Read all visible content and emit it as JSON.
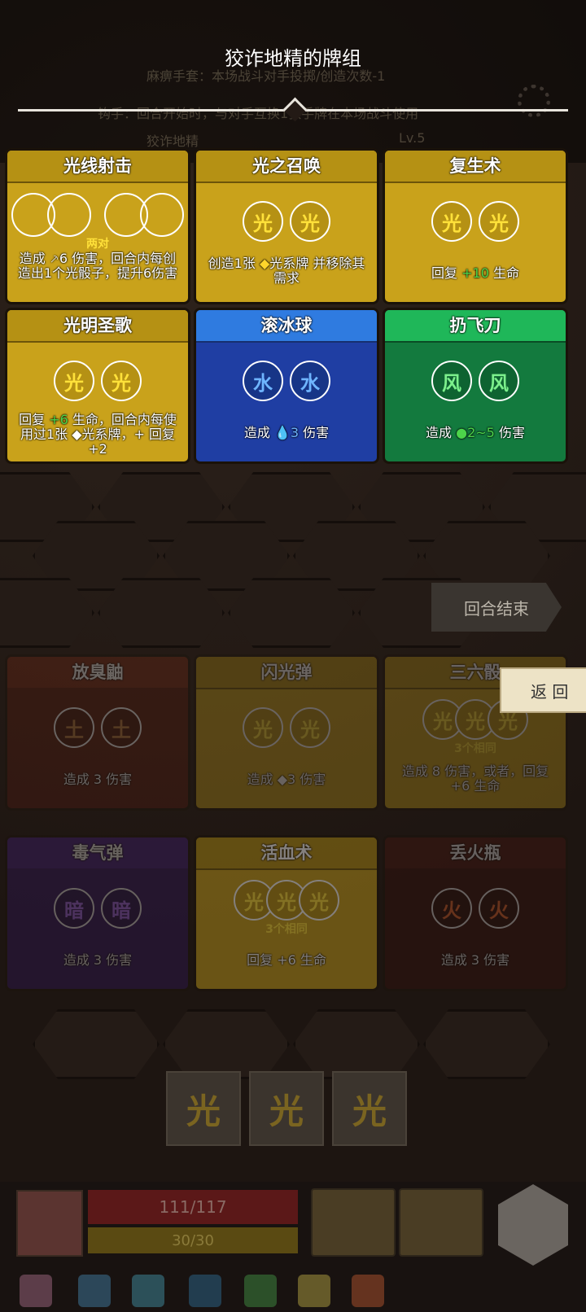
{
  "deck_title": "狡诈地精的牌组",
  "background_text": {
    "line1": "麻痹手套：本场战斗对手投掷/创造次数-1",
    "line2": "钩手：回合开始时，与对手互换1张手牌在本场战斗使用",
    "enemy_name": "狡诈地精",
    "enemy_level": "Lv.5"
  },
  "cards": [
    {
      "title": "光线射击",
      "color": "yellow",
      "dice": [
        "",
        "",
        "",
        ""
      ],
      "dice_label": "两对",
      "desc": [
        "造成 ",
        "6",
        " 伤害，回合内每创造出1个光骰子，提升6伤害"
      ]
    },
    {
      "title": "光之召唤",
      "color": "yellow",
      "dice": [
        "光",
        "光"
      ],
      "desc": [
        "创造1张 ",
        "◆",
        "光系牌 并移除其需求"
      ]
    },
    {
      "title": "复生术",
      "color": "yellow",
      "dice": [
        "光",
        "光"
      ],
      "desc": [
        "回复 ",
        "+10",
        " 生命"
      ]
    },
    {
      "title": "光明圣歌",
      "color": "yellow",
      "dice": [
        "光",
        "光"
      ],
      "desc": [
        "回复 ",
        "+6",
        " 生命，回合内每使用过1张 ◆光系牌，+ 回复+2"
      ]
    },
    {
      "title": "滚冰球",
      "color": "blue",
      "dice": [
        "水",
        "水"
      ],
      "desc": [
        "造成 ",
        "3",
        " 伤害"
      ]
    },
    {
      "title": "扔飞刀",
      "color": "green",
      "dice": [
        "风",
        "风"
      ],
      "desc": [
        "造成 ",
        "2~5",
        " 伤害"
      ]
    }
  ],
  "dim_cards": [
    {
      "title": "放臭鼬",
      "style": "dimred",
      "dice": [
        "土",
        "土"
      ],
      "desc": "造成 3 伤害"
    },
    {
      "title": "闪光弹",
      "style": "yellow",
      "dice": [
        "光",
        "光"
      ],
      "desc": "造成 ◆3 伤害"
    },
    {
      "title": "三六骰",
      "style": "yellow",
      "dice": [
        "光",
        "光",
        "光"
      ],
      "dice_label": "3个相同",
      "desc": "造成 8 伤害，或者，回复 +6 生命"
    },
    {
      "title": "毒气弹",
      "style": "dimpurple",
      "dice": [
        "暗",
        "暗"
      ],
      "desc": "造成 3 伤害"
    },
    {
      "title": "活血术",
      "style": "yellow",
      "dice": [
        "光",
        "光",
        "光"
      ],
      "dice_label": "3个相同",
      "desc": "回复 +6 生命"
    },
    {
      "title": "丢火瓶",
      "style": "dimdark",
      "dice": [
        "火",
        "火"
      ],
      "desc": "造成 3 伤害"
    }
  ],
  "end_turn_label": "回合结束",
  "back_label": "返 回",
  "hand_dice": [
    "光",
    "光",
    "光"
  ],
  "player": {
    "hp": "111/117",
    "mp": "30/30"
  },
  "colors": {
    "light": "#c9a21b",
    "water": "#1f3ea3",
    "wind": "#137a3e"
  }
}
